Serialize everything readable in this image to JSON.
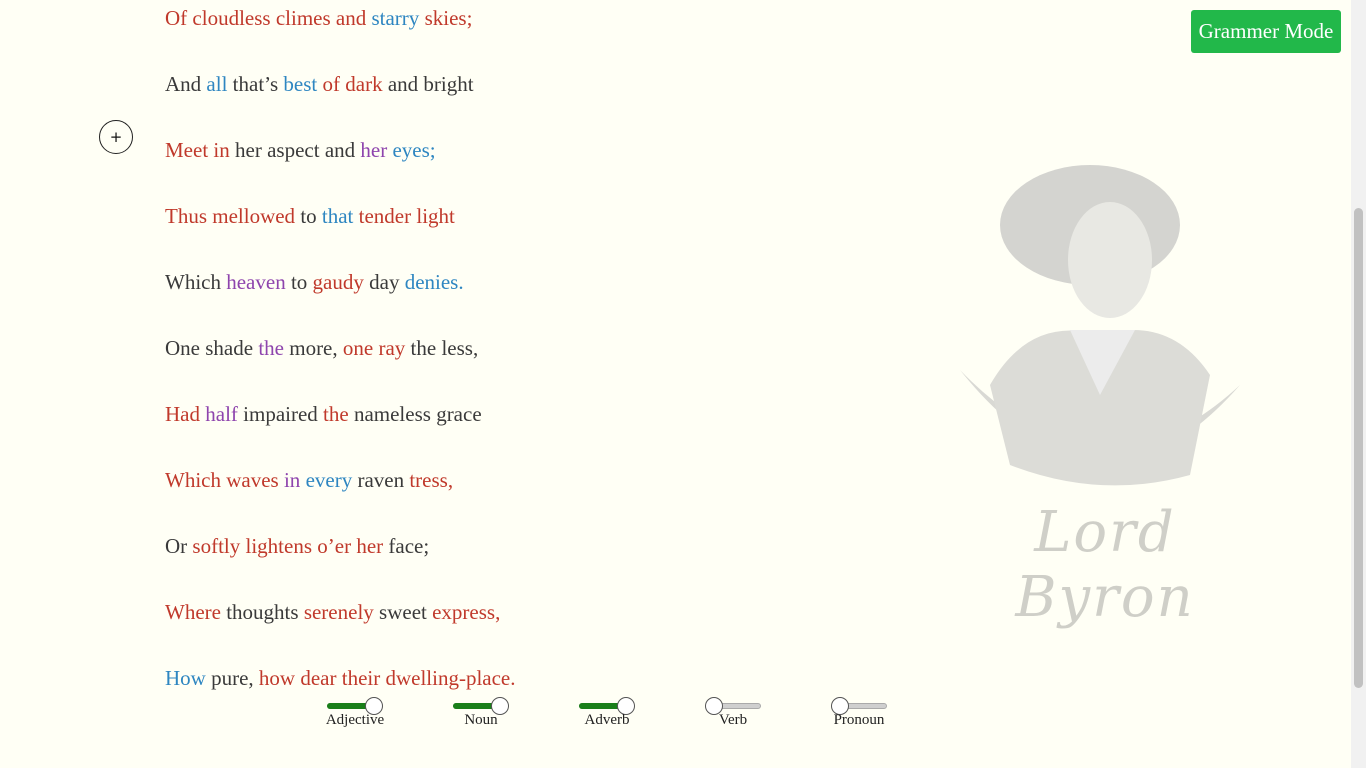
{
  "poem": {
    "lines": [
      [
        {
          "t": "Of",
          "c": "red"
        },
        {
          "t": " "
        },
        {
          "t": "cloudless",
          "c": "red"
        },
        {
          "t": " "
        },
        {
          "t": "climes",
          "c": "red"
        },
        {
          "t": " "
        },
        {
          "t": "and",
          "c": "red"
        },
        {
          "t": " "
        },
        {
          "t": "starry",
          "c": "blue"
        },
        {
          "t": " "
        },
        {
          "t": "skies;",
          "c": "red"
        }
      ],
      [
        {
          "t": "And",
          "c": "dark"
        },
        {
          "t": " "
        },
        {
          "t": "all",
          "c": "blue"
        },
        {
          "t": " "
        },
        {
          "t": "that’s",
          "c": "dark"
        },
        {
          "t": " "
        },
        {
          "t": "best",
          "c": "blue"
        },
        {
          "t": " "
        },
        {
          "t": "of",
          "c": "red"
        },
        {
          "t": " "
        },
        {
          "t": "dark",
          "c": "red"
        },
        {
          "t": " "
        },
        {
          "t": "and",
          "c": "dark"
        },
        {
          "t": " "
        },
        {
          "t": "bright",
          "c": "dark"
        }
      ],
      [
        {
          "t": "Meet",
          "c": "red"
        },
        {
          "t": " "
        },
        {
          "t": "in",
          "c": "red"
        },
        {
          "t": " "
        },
        {
          "t": "her",
          "c": "dark"
        },
        {
          "t": " "
        },
        {
          "t": "aspect",
          "c": "dark"
        },
        {
          "t": " "
        },
        {
          "t": "and",
          "c": "dark"
        },
        {
          "t": " "
        },
        {
          "t": "her",
          "c": "purple"
        },
        {
          "t": " "
        },
        {
          "t": "eyes;",
          "c": "blue"
        }
      ],
      [
        {
          "t": "Thus",
          "c": "red"
        },
        {
          "t": " "
        },
        {
          "t": "mellowed",
          "c": "red"
        },
        {
          "t": " "
        },
        {
          "t": "to",
          "c": "dark"
        },
        {
          "t": " "
        },
        {
          "t": "that",
          "c": "blue"
        },
        {
          "t": " "
        },
        {
          "t": "tender",
          "c": "red"
        },
        {
          "t": " "
        },
        {
          "t": "light",
          "c": "red"
        }
      ],
      [
        {
          "t": "Which",
          "c": "dark"
        },
        {
          "t": " "
        },
        {
          "t": "heaven",
          "c": "purple"
        },
        {
          "t": " "
        },
        {
          "t": "to",
          "c": "dark"
        },
        {
          "t": " "
        },
        {
          "t": "gaudy",
          "c": "red"
        },
        {
          "t": " "
        },
        {
          "t": "day",
          "c": "dark"
        },
        {
          "t": " "
        },
        {
          "t": "denies.",
          "c": "blue"
        }
      ],
      [
        {
          "t": "One",
          "c": "dark"
        },
        {
          "t": " "
        },
        {
          "t": "shade",
          "c": "dark"
        },
        {
          "t": " "
        },
        {
          "t": "the",
          "c": "purple"
        },
        {
          "t": " "
        },
        {
          "t": "more,",
          "c": "dark"
        },
        {
          "t": " "
        },
        {
          "t": "one",
          "c": "red"
        },
        {
          "t": " "
        },
        {
          "t": "ray",
          "c": "red"
        },
        {
          "t": " "
        },
        {
          "t": "the",
          "c": "dark"
        },
        {
          "t": " "
        },
        {
          "t": "less,",
          "c": "dark"
        }
      ],
      [
        {
          "t": "Had",
          "c": "red"
        },
        {
          "t": " "
        },
        {
          "t": "half",
          "c": "purple"
        },
        {
          "t": " "
        },
        {
          "t": "impaired",
          "c": "dark"
        },
        {
          "t": " "
        },
        {
          "t": "the",
          "c": "red"
        },
        {
          "t": " "
        },
        {
          "t": "nameless",
          "c": "dark"
        },
        {
          "t": " "
        },
        {
          "t": "grace",
          "c": "dark"
        }
      ],
      [
        {
          "t": "Which",
          "c": "red"
        },
        {
          "t": " "
        },
        {
          "t": "waves",
          "c": "red"
        },
        {
          "t": " "
        },
        {
          "t": "in",
          "c": "purple"
        },
        {
          "t": " "
        },
        {
          "t": "every",
          "c": "blue"
        },
        {
          "t": " "
        },
        {
          "t": "raven",
          "c": "dark"
        },
        {
          "t": " "
        },
        {
          "t": "tress,",
          "c": "red"
        }
      ],
      [
        {
          "t": "Or",
          "c": "dark"
        },
        {
          "t": " "
        },
        {
          "t": "softly",
          "c": "red"
        },
        {
          "t": " "
        },
        {
          "t": "lightens",
          "c": "red"
        },
        {
          "t": " "
        },
        {
          "t": "o’er",
          "c": "red"
        },
        {
          "t": " "
        },
        {
          "t": "her",
          "c": "red"
        },
        {
          "t": " "
        },
        {
          "t": "face;",
          "c": "dark"
        }
      ],
      [
        {
          "t": "Where",
          "c": "red"
        },
        {
          "t": " "
        },
        {
          "t": "thoughts",
          "c": "dark"
        },
        {
          "t": " "
        },
        {
          "t": "serenely",
          "c": "red"
        },
        {
          "t": " "
        },
        {
          "t": "sweet",
          "c": "dark"
        },
        {
          "t": " "
        },
        {
          "t": "express,",
          "c": "red"
        }
      ],
      [
        {
          "t": "How",
          "c": "blue"
        },
        {
          "t": " "
        },
        {
          "t": "pure,",
          "c": "dark"
        },
        {
          "t": " "
        },
        {
          "t": "how",
          "c": "red"
        },
        {
          "t": " "
        },
        {
          "t": "dear",
          "c": "red"
        },
        {
          "t": " "
        },
        {
          "t": "their",
          "c": "red"
        },
        {
          "t": " "
        },
        {
          "t": "dwelling-place.",
          "c": "red"
        }
      ]
    ]
  },
  "colors": {
    "red": "#c0392b",
    "blue": "#2e86c1",
    "purple": "#8e44ad",
    "dark": "#3a3a3a",
    "accent": "#22b84a"
  },
  "header": {
    "mode_button_label": "Grammer Mode"
  },
  "controls": {
    "add_button_label": "+"
  },
  "portrait": {
    "signature": "Lord Byron"
  },
  "sliders": [
    {
      "label": "Adjective",
      "value": 1
    },
    {
      "label": "Noun",
      "value": 1
    },
    {
      "label": "Adverb",
      "value": 1
    },
    {
      "label": "Verb",
      "value": 0
    },
    {
      "label": "Pronoun",
      "value": 0
    }
  ]
}
